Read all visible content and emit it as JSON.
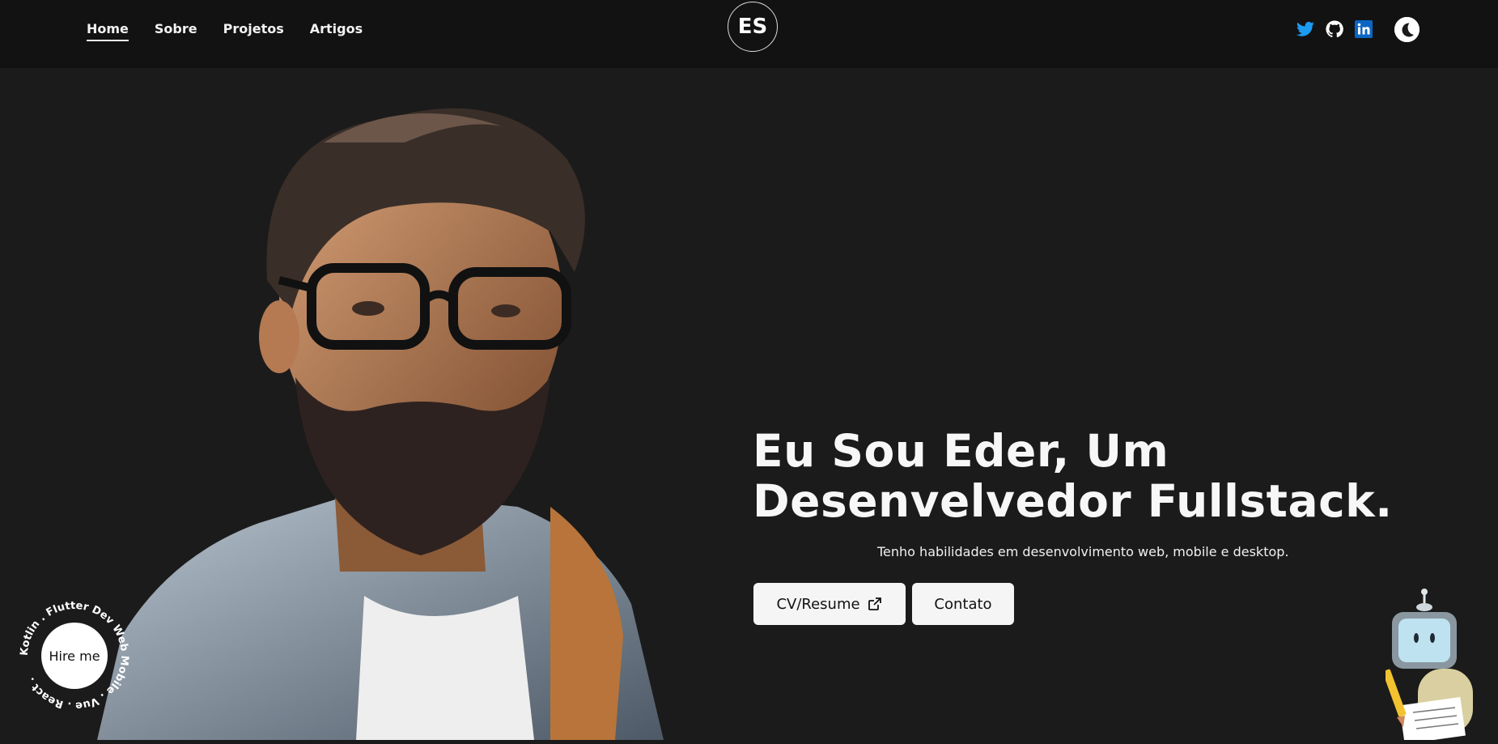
{
  "nav": {
    "links": [
      {
        "label": "Home",
        "active": true
      },
      {
        "label": "Sobre",
        "active": false
      },
      {
        "label": "Projetos",
        "active": false
      },
      {
        "label": "Artigos",
        "active": false
      }
    ]
  },
  "logo": {
    "text": "ES"
  },
  "socials": {
    "icons": [
      "twitter-icon",
      "github-icon",
      "linkedin-icon"
    ],
    "theme_icon": "moon-icon"
  },
  "hero": {
    "title_line1": "Eu Sou Eder, Um",
    "title_line2": "Desenvelvedor Fullstack.",
    "subtitle": "Tenho habilidades em desenvolvimento web, mobile e desktop.",
    "cv_button": "CV/Resume",
    "contact_button": "Contato"
  },
  "hire": {
    "label": "Hire me",
    "ring_text": "Kotlin . Flutter Dev Web Mobile . Vue . React ."
  },
  "colors": {
    "background": "#1b1b1b",
    "topbar": "#121212",
    "twitter": "#1d9bf0",
    "linkedin": "#0a66c2",
    "text": "#f5f5f5"
  }
}
